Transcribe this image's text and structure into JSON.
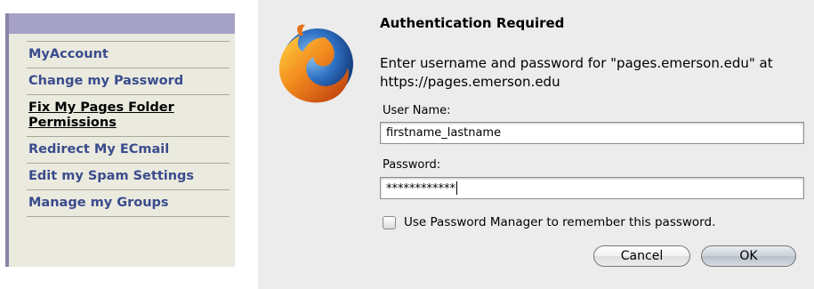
{
  "sidebar": {
    "items": [
      {
        "label": "MyAccount"
      },
      {
        "label": "Change my Password"
      },
      {
        "label": "Fix My Pages Folder Permissions",
        "current": true
      },
      {
        "label": "Redirect My ECmail"
      },
      {
        "label": "Edit my Spam Settings"
      },
      {
        "label": "Manage my Groups"
      }
    ]
  },
  "dialog": {
    "icon": "firefox-logo-icon",
    "title": "Authentication Required",
    "message": "Enter username and password for \"pages.emerson.edu\" at https://pages.emerson.edu",
    "username_label": "User Name:",
    "username_value": "firstname_lastname",
    "password_label": "Password:",
    "password_value": "************",
    "checkbox_label": "Use Password Manager to remember this password.",
    "checkbox_checked": false,
    "cancel_label": "Cancel",
    "ok_label": "OK"
  },
  "colors": {
    "sidebar_bg": "#ebeadf",
    "sidebar_header": "#a6a2c6",
    "link": "#3a4c8c",
    "dialog_bg": "#ececec"
  }
}
